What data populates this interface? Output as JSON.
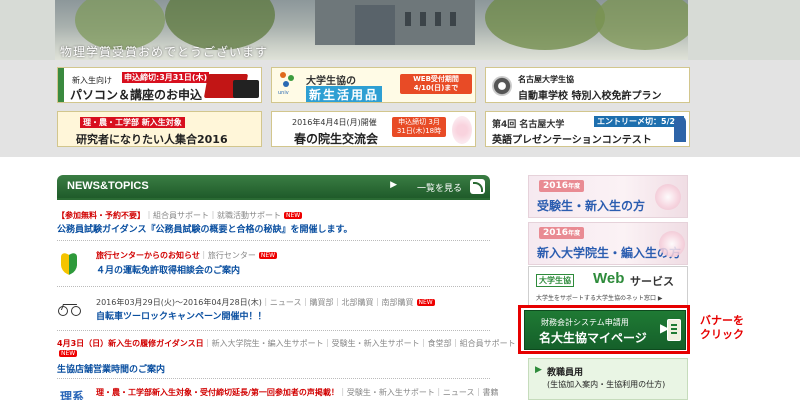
{
  "hero": {
    "caption": "物理学賞受賞おめでとうございます"
  },
  "banners": [
    {
      "sub": "新入生向け",
      "badge": "申込締切:3月31日(木)",
      "main": "パソコン＆講座のお申込"
    },
    {
      "sub": "大学生協の",
      "main": "新生活用品",
      "badge": "WEB受付期間 4/10(日)まで",
      "logo": "univ coop"
    },
    {
      "sub": "名古屋大学生協",
      "main": "自動車学校 特別入校免許プラン"
    },
    {
      "sub": "理・農・工学部 新入生対象",
      "main": "研究者になりたい人集合2016"
    },
    {
      "sub": "2016年4月4日(月)開催",
      "main": "春の院生交流会",
      "badge": "申込締切 3月31日(木)18時"
    },
    {
      "sub": "第4回 名古屋大学",
      "badge": "エントリー〆切：5/27",
      "main": "英語プレゼンテーションコンテスト"
    }
  ],
  "news": {
    "title": "NEWS&TOPICS",
    "more_label": "一覧を見る",
    "new_label": "NEW",
    "items": [
      {
        "meta_red": "【参加無料・予約不要】",
        "meta_rest": "｜組合員サポート｜就職活動サポート",
        "title": "公務員試験ガイダンス『公務員試験の概要と合格の秘訣』を開催します。"
      },
      {
        "meta_red": "旅行センターからのお知らせ",
        "meta_rest": "｜旅行センター",
        "title": "４月の運転免許取得相談会のご案内"
      },
      {
        "meta_date": "2016年03月29日(火)～2016年04月28日(木)",
        "meta_rest": "｜ニュース｜購買部｜北部購買｜南部購買",
        "title": "自転車ツーロックキャンペーン開催中！！"
      },
      {
        "meta_red": "4月3日（日）新入生の履修ガイダンス日",
        "meta_rest": "｜新入大学院生・編入生サポート｜受験生・新入生サポート｜食堂部｜組合員サポート",
        "title": "生協店舗営業時間のご案内"
      },
      {
        "meta_red": "理・農・工学部新入生対象・受付締切延長/第一回参加者の声掲載！",
        "meta_rest": "｜受験生・新入生サポート｜ニュース｜書籍",
        "icon_text": "理系"
      }
    ]
  },
  "side": {
    "season1": {
      "tag": "2016",
      "tag_small": "年度",
      "label": "受験生・新入生の方"
    },
    "season2": {
      "tag": "2016",
      "tag_small": "年度",
      "label": "新入大学院生・編入生の方"
    },
    "web": {
      "pill": "大学生協",
      "w1": "Web",
      "w2": "サービス",
      "sub": "大学生をサポートする大学生協のネット窓口 ▶"
    },
    "mypage": {
      "s1": "財務会計システム申請用",
      "s2": "名大生協マイページ",
      "arrow": "▶"
    },
    "kyoin": {
      "title": "教職員用",
      "sub": "(生協加入案内・生協利用の仕方)",
      "chev": "▶"
    },
    "click_note_1": "バナーを",
    "click_note_2": "クリック"
  },
  "colors": {
    "accent_green": "#1f7a34",
    "highlight_red": "#e60000",
    "link_blue": "#0a4fa0"
  }
}
